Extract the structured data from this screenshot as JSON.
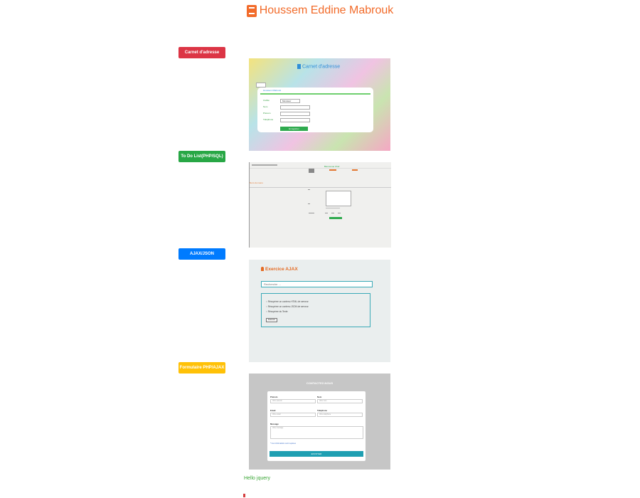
{
  "header": {
    "title": "Houssem Eddine Mabrouk",
    "icon": "book-icon",
    "color": "#f26b2a"
  },
  "projects": [
    {
      "label": "Carnet d'adresse",
      "color": "#dc3545"
    },
    {
      "label": "To Do List(PHP/SQL)",
      "color": "#28a745"
    },
    {
      "label": "AJAX/JSON",
      "color": "#007bff"
    },
    {
      "label": "Formulaire PHP/AJAX",
      "color": "#ffc107"
    }
  ],
  "card1": {
    "title": "Carnet d'adresse",
    "form_header": "Houssem Mabrouk",
    "field_labels": [
      "Civilité",
      "Nom",
      "Prénom",
      "Téléphone"
    ],
    "civilite_value": "Monsieur",
    "save_label": "Enregistrer"
  },
  "card2": {
    "top_text": "Bienvenue Chef",
    "left_text": "Nom du menu"
  },
  "card3": {
    "title": "Exercice AJAX",
    "search_placeholder": "Recherche ...",
    "items": [
      "Récupérer un contenu HTML de serveur",
      "Récupérer un contenu JSON de serveur",
      "Récupérer du Texte"
    ],
    "button_label": "Exécuter"
  },
  "card4": {
    "title": "CONTACTEZ-NOUS",
    "fields": {
      "prenom": {
        "label": "Prénom",
        "placeholder": "Votre prénom"
      },
      "nom": {
        "label": "Nom",
        "placeholder": "Votre nom"
      },
      "email": {
        "label": "Email",
        "placeholder": "Votre email"
      },
      "telephone": {
        "label": "Téléphone",
        "placeholder": "Votre téléphone"
      },
      "message": {
        "label": "Message",
        "placeholder": "Votre message"
      }
    },
    "note": "* Ces informations sont requises",
    "submit_label": "ENVOYER"
  },
  "footer": {
    "hello": "Hello jquery"
  }
}
